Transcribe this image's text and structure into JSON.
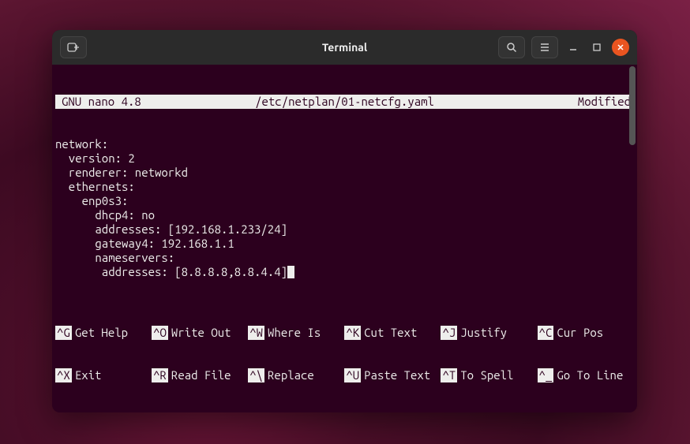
{
  "titlebar": {
    "title": "Terminal"
  },
  "nano": {
    "app_name": "GNU nano 4.8",
    "file_path": "/etc/netplan/01-netcfg.yaml",
    "status": "Modified"
  },
  "editor_lines": [
    "network:",
    "  version: 2",
    "  renderer: networkd",
    "  ethernets:",
    "    enp0s3:",
    "      dhcp4: no",
    "      addresses: [192.168.1.233/24]",
    "      gateway4: 192.168.1.1",
    "      nameservers:",
    "       addresses: [8.8.8.8,8.8.4.4]"
  ],
  "shortcuts_row1": [
    {
      "key": "^G",
      "desc": "Get Help"
    },
    {
      "key": "^O",
      "desc": "Write Out"
    },
    {
      "key": "^W",
      "desc": "Where Is"
    },
    {
      "key": "^K",
      "desc": "Cut Text"
    },
    {
      "key": "^J",
      "desc": "Justify"
    },
    {
      "key": "^C",
      "desc": "Cur Pos"
    }
  ],
  "shortcuts_row2": [
    {
      "key": "^X",
      "desc": "Exit"
    },
    {
      "key": "^R",
      "desc": "Read File"
    },
    {
      "key": "^\\",
      "desc": "Replace"
    },
    {
      "key": "^U",
      "desc": "Paste Text"
    },
    {
      "key": "^T",
      "desc": "To Spell"
    },
    {
      "key": "^_",
      "desc": "Go To Line"
    }
  ]
}
